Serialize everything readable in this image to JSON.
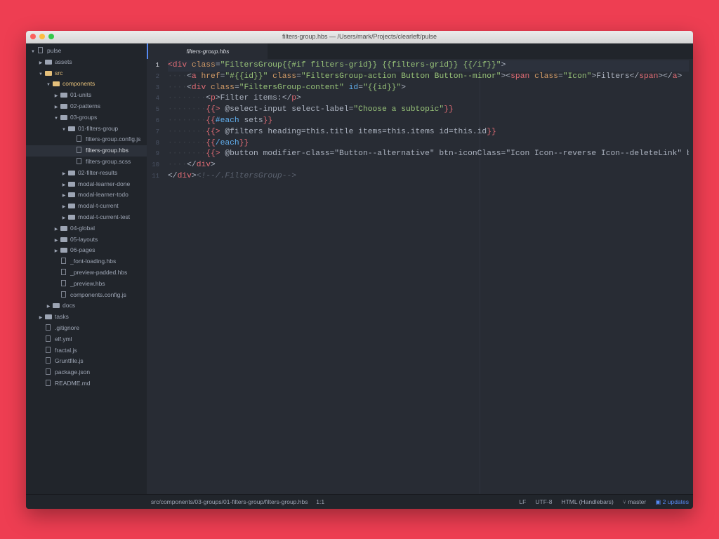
{
  "window": {
    "title": "filters-group.hbs — /Users/mark/Projects/clearleft/pulse"
  },
  "sidebar": {
    "items": [
      {
        "label": "pulse",
        "depth": 0,
        "type": "repo",
        "open": true
      },
      {
        "label": "assets",
        "depth": 1,
        "type": "folder",
        "open": false
      },
      {
        "label": "src",
        "depth": 1,
        "type": "folder",
        "open": true,
        "accent": "#e5c07b"
      },
      {
        "label": "components",
        "depth": 2,
        "type": "folder",
        "open": true,
        "accent": "#e5c07b"
      },
      {
        "label": "01-units",
        "depth": 3,
        "type": "folder",
        "open": false
      },
      {
        "label": "02-patterns",
        "depth": 3,
        "type": "folder",
        "open": false
      },
      {
        "label": "03-groups",
        "depth": 3,
        "type": "folder",
        "open": true
      },
      {
        "label": "01-filters-group",
        "depth": 4,
        "type": "folder",
        "open": true
      },
      {
        "label": "filters-group.config.js",
        "depth": 5,
        "type": "file"
      },
      {
        "label": "filters-group.hbs",
        "depth": 5,
        "type": "file",
        "selected": true
      },
      {
        "label": "filters-group.scss",
        "depth": 5,
        "type": "file"
      },
      {
        "label": "02-filter-results",
        "depth": 4,
        "type": "folder",
        "open": false
      },
      {
        "label": "modal-learner-done",
        "depth": 4,
        "type": "folder",
        "open": false
      },
      {
        "label": "modal-learner-todo",
        "depth": 4,
        "type": "folder",
        "open": false
      },
      {
        "label": "modal-t-current",
        "depth": 4,
        "type": "folder",
        "open": false
      },
      {
        "label": "modal-t-current-test",
        "depth": 4,
        "type": "folder",
        "open": false
      },
      {
        "label": "04-global",
        "depth": 3,
        "type": "folder",
        "open": false
      },
      {
        "label": "05-layouts",
        "depth": 3,
        "type": "folder",
        "open": false
      },
      {
        "label": "06-pages",
        "depth": 3,
        "type": "folder",
        "open": false
      },
      {
        "label": "_font-loading.hbs",
        "depth": 3,
        "type": "file"
      },
      {
        "label": "_preview-padded.hbs",
        "depth": 3,
        "type": "file"
      },
      {
        "label": "_preview.hbs",
        "depth": 3,
        "type": "file"
      },
      {
        "label": "components.config.js",
        "depth": 3,
        "type": "file"
      },
      {
        "label": "docs",
        "depth": 2,
        "type": "folder",
        "open": false
      },
      {
        "label": "tasks",
        "depth": 1,
        "type": "folder",
        "open": false
      },
      {
        "label": ".gitignore",
        "depth": 1,
        "type": "file"
      },
      {
        "label": "elf.yml",
        "depth": 1,
        "type": "file"
      },
      {
        "label": "fractal.js",
        "depth": 1,
        "type": "file"
      },
      {
        "label": "Gruntfile.js",
        "depth": 1,
        "type": "file"
      },
      {
        "label": "package.json",
        "depth": 1,
        "type": "file"
      },
      {
        "label": "README.md",
        "depth": 1,
        "type": "file"
      }
    ]
  },
  "editor": {
    "tab": "filters-group.hbs",
    "current_line": 1,
    "lines": [
      [
        [
          "tag",
          "<div"
        ],
        [
          "txt",
          " "
        ],
        [
          "attr",
          "class"
        ],
        [
          "txt",
          "="
        ],
        [
          "str",
          "\"FiltersGroup{{#if filters-grid}} {{filters-grid}} {{/if}}\""
        ],
        [
          "txt",
          ">"
        ]
      ],
      [
        [
          "ind",
          "····"
        ],
        [
          "txt",
          "<"
        ],
        [
          "tag",
          "a"
        ],
        [
          "txt",
          " "
        ],
        [
          "attr",
          "href"
        ],
        [
          "txt",
          "="
        ],
        [
          "str",
          "\"#{{id}}\""
        ],
        [
          "txt",
          " "
        ],
        [
          "attr",
          "class"
        ],
        [
          "txt",
          "="
        ],
        [
          "str",
          "\"FiltersGroup-action Button Button--minor\""
        ],
        [
          "txt",
          ">"
        ],
        [
          "txt",
          "<"
        ],
        [
          "tag",
          "span"
        ],
        [
          "txt",
          " "
        ],
        [
          "attr",
          "class"
        ],
        [
          "txt",
          "="
        ],
        [
          "str",
          "\"Icon\""
        ],
        [
          "txt",
          ">Filters</"
        ],
        [
          "tag",
          "span"
        ],
        [
          "txt",
          "></"
        ],
        [
          "tag",
          "a"
        ],
        [
          "txt",
          ">"
        ]
      ],
      [
        [
          "ind",
          "····"
        ],
        [
          "txt",
          "<"
        ],
        [
          "tag",
          "div"
        ],
        [
          "txt",
          " "
        ],
        [
          "attr",
          "class"
        ],
        [
          "txt",
          "="
        ],
        [
          "str",
          "\"FiltersGroup-content\""
        ],
        [
          "txt",
          " "
        ],
        [
          "kw",
          "id"
        ],
        [
          "txt",
          "="
        ],
        [
          "str",
          "\"{{id}}\""
        ],
        [
          "txt",
          ">"
        ]
      ],
      [
        [
          "ind",
          "········"
        ],
        [
          "txt",
          "<"
        ],
        [
          "tag",
          "p"
        ],
        [
          "txt",
          ">Filter items:</"
        ],
        [
          "tag",
          "p"
        ],
        [
          "txt",
          ">"
        ]
      ],
      [
        [
          "ind",
          "········"
        ],
        [
          "hb",
          "{{>"
        ],
        [
          "txt",
          " @select-input select-label="
        ],
        [
          "str",
          "\"Choose a subtopic\""
        ],
        [
          "hb",
          "}}"
        ]
      ],
      [
        [
          "ind",
          "········"
        ],
        [
          "hb",
          "{{"
        ],
        [
          "kw",
          "#each"
        ],
        [
          "txt",
          " sets"
        ],
        [
          "hb",
          "}}"
        ]
      ],
      [
        [
          "ind",
          "········"
        ],
        [
          "hb",
          "{{>"
        ],
        [
          "txt",
          " @filters heading=this.title items=this.items id=this.id"
        ],
        [
          "hb",
          "}}"
        ]
      ],
      [
        [
          "ind",
          "········"
        ],
        [
          "hb",
          "{{"
        ],
        [
          "kw",
          "/each"
        ],
        [
          "hb",
          "}}"
        ]
      ],
      [
        [
          "ind",
          "········"
        ],
        [
          "hb",
          "{{>"
        ],
        [
          "txt",
          " @button modifier-class=\"Button--alternative\" btn-iconClass=\"Icon Icon--reverse Icon--deleteLink\" button-text=\"Reset all fi"
        ]
      ],
      [
        [
          "ind",
          "····"
        ],
        [
          "txt",
          "</"
        ],
        [
          "tag",
          "div"
        ],
        [
          "txt",
          ">"
        ]
      ],
      [
        [
          "txt",
          "</"
        ],
        [
          "tag",
          "div"
        ],
        [
          "txt",
          ">"
        ],
        [
          "com",
          "<!--/.FiltersGroup-->"
        ]
      ]
    ]
  },
  "status": {
    "path": "src/components/03-groups/01-filters-group/filters-group.hbs",
    "cursor": "1:1",
    "line_ending": "LF",
    "encoding": "UTF-8",
    "grammar": "HTML (Handlebars)",
    "branch": "master",
    "updates": "2 updates"
  },
  "colors": {
    "background": "#ee3e52",
    "accent": "#568af2"
  }
}
